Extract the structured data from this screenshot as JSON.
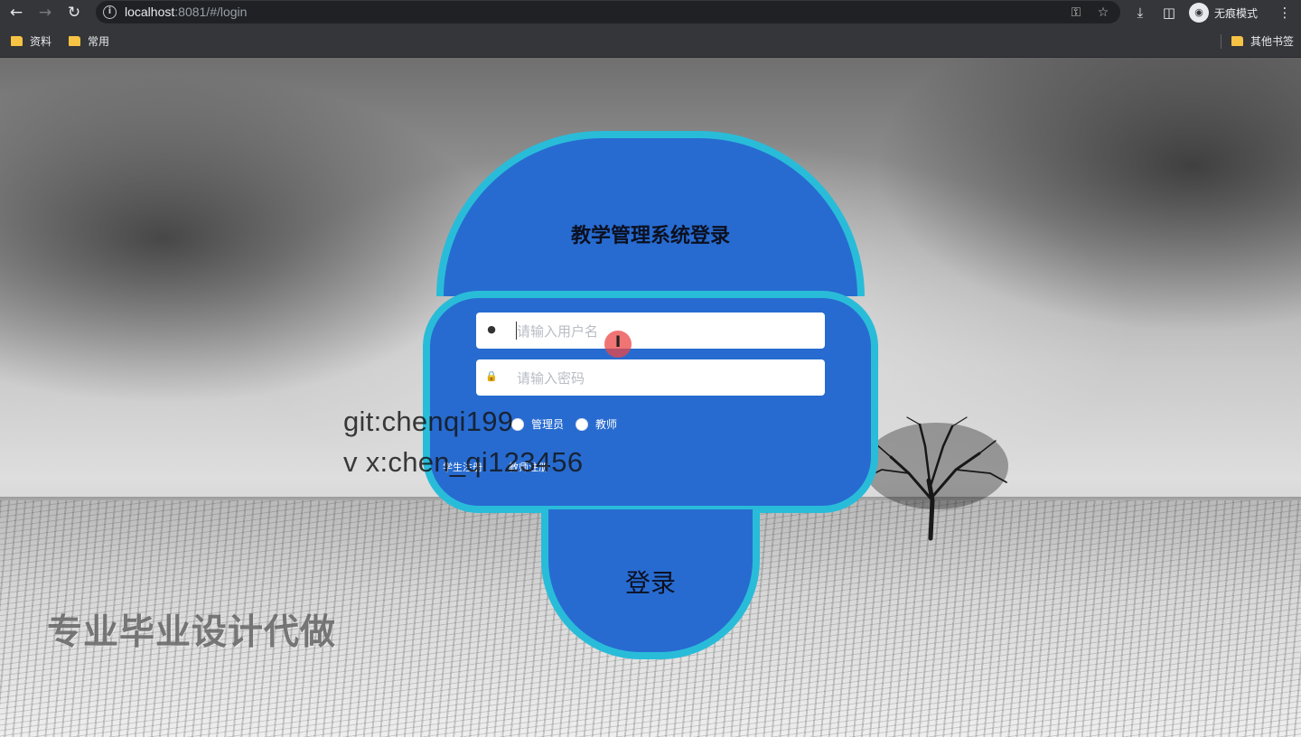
{
  "browser": {
    "url_host": "localhost",
    "url_rest": ":8081/#/login",
    "incognito_label": "无痕模式",
    "bookmarks": [
      "资料",
      "常用"
    ],
    "other_bookmarks": "其他书签"
  },
  "login": {
    "title": "教学管理系统登录",
    "username_placeholder": "请输入用户名",
    "password_placeholder": "请输入密码",
    "role_options": [
      "管理员",
      "教师"
    ],
    "register_links": [
      "学生注册",
      "教师注册"
    ],
    "login_button": "登录"
  },
  "watermark": {
    "line1": "git:chenqi199",
    "line2": "v x:chen_qi123456",
    "promo": "专业毕业设计代做"
  },
  "colors": {
    "card_fill": "#276bd0",
    "card_border": "#29bcd9"
  }
}
